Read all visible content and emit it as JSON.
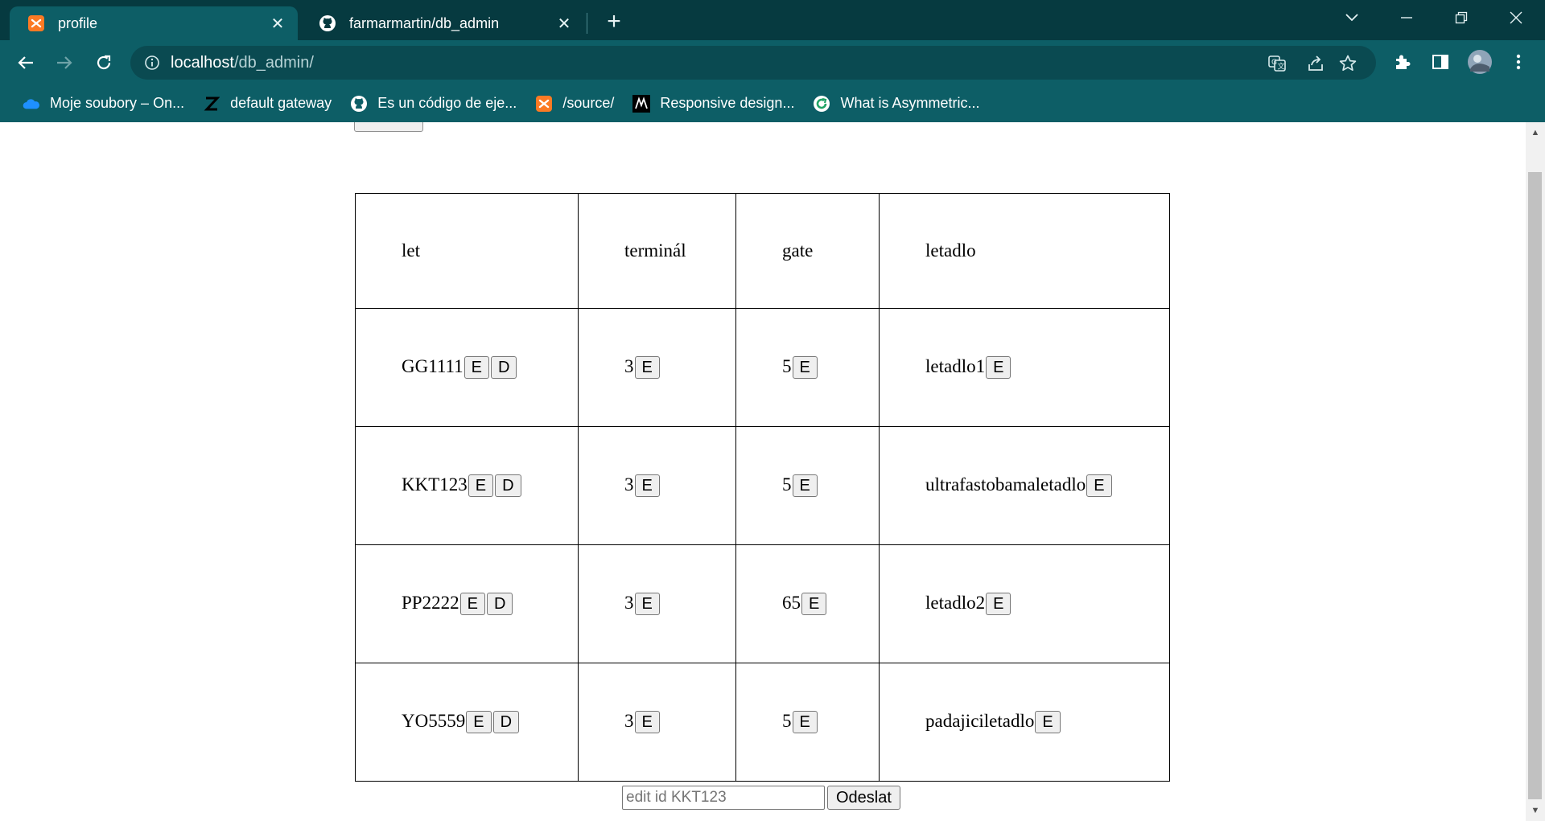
{
  "browser": {
    "tabs": [
      {
        "title": "profile",
        "icon": "xampp-icon"
      },
      {
        "title": "farmarmartin/db_admin",
        "icon": "github-icon"
      }
    ],
    "url_host": "localhost",
    "url_path": "/db_admin/",
    "bookmarks": [
      {
        "label": "Moje soubory – On...",
        "icon": "onedrive-icon"
      },
      {
        "label": "default gateway",
        "icon": "z-icon"
      },
      {
        "label": "Es un código de eje...",
        "icon": "github-icon"
      },
      {
        "label": "/source/",
        "icon": "xampp-icon"
      },
      {
        "label": "Responsive design...",
        "icon": "m-icon"
      },
      {
        "label": "What is Asymmetric...",
        "icon": "refresh-circle-icon"
      }
    ]
  },
  "table": {
    "headers": [
      "let",
      "terminál",
      "gate",
      "letadlo"
    ],
    "rows": [
      {
        "let": "GG1111",
        "terminal": "3",
        "gate": "5",
        "letadlo": "letadlo1"
      },
      {
        "let": "KKT123",
        "terminal": "3",
        "gate": "5",
        "letadlo": "ultrafastobamaletadlo"
      },
      {
        "let": "PP2222",
        "terminal": "3",
        "gate": "65",
        "letadlo": "letadlo2"
      },
      {
        "let": "YO5559",
        "terminal": "3",
        "gate": "5",
        "letadlo": "padajiciletadlo"
      }
    ],
    "edit_label": "E",
    "delete_label": "D"
  },
  "form": {
    "placeholder": "edit id KKT123",
    "value": "",
    "submit_label": "Odeslat"
  },
  "colors": {
    "tabstrip": "#063a40",
    "toolbar": "#0d5e66"
  }
}
